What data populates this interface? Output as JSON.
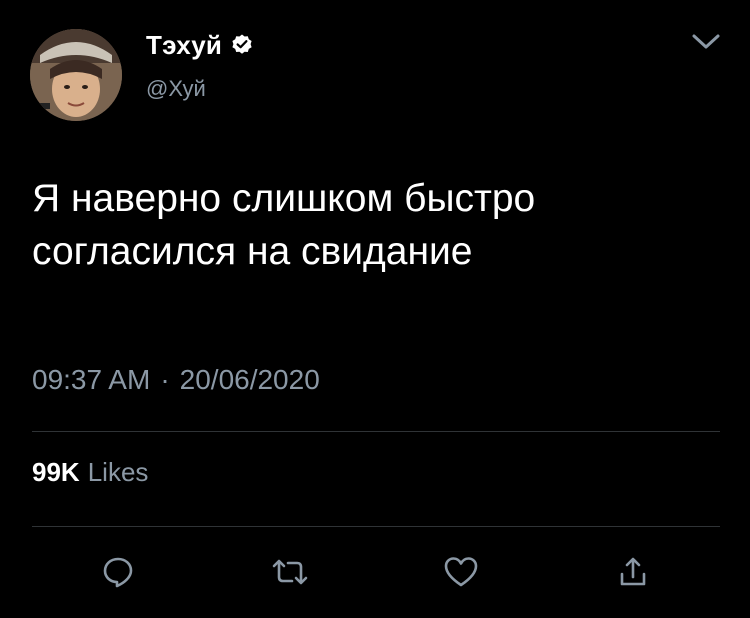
{
  "author": {
    "display_name": "Тэхуй",
    "handle": "@Хуй",
    "verified": true,
    "avatar_icon": "profile-photo"
  },
  "tweet": {
    "text": "Я наверно слишком быстро\nсогласился на свидание",
    "time": "09:37 AM",
    "separator": "·",
    "date": "20/06/2020"
  },
  "stats": {
    "likes_count": "99K",
    "likes_label": "Likes"
  },
  "actions": [
    {
      "name": "reply",
      "icon": "reply-icon"
    },
    {
      "name": "retweet",
      "icon": "retweet-icon"
    },
    {
      "name": "like",
      "icon": "heart-icon"
    },
    {
      "name": "share",
      "icon": "share-icon"
    }
  ],
  "colors": {
    "background": "#000000",
    "text_primary": "#ffffff",
    "text_secondary": "#8b98a5",
    "divider": "#2f3336",
    "verified_badge": "#ffffff"
  }
}
